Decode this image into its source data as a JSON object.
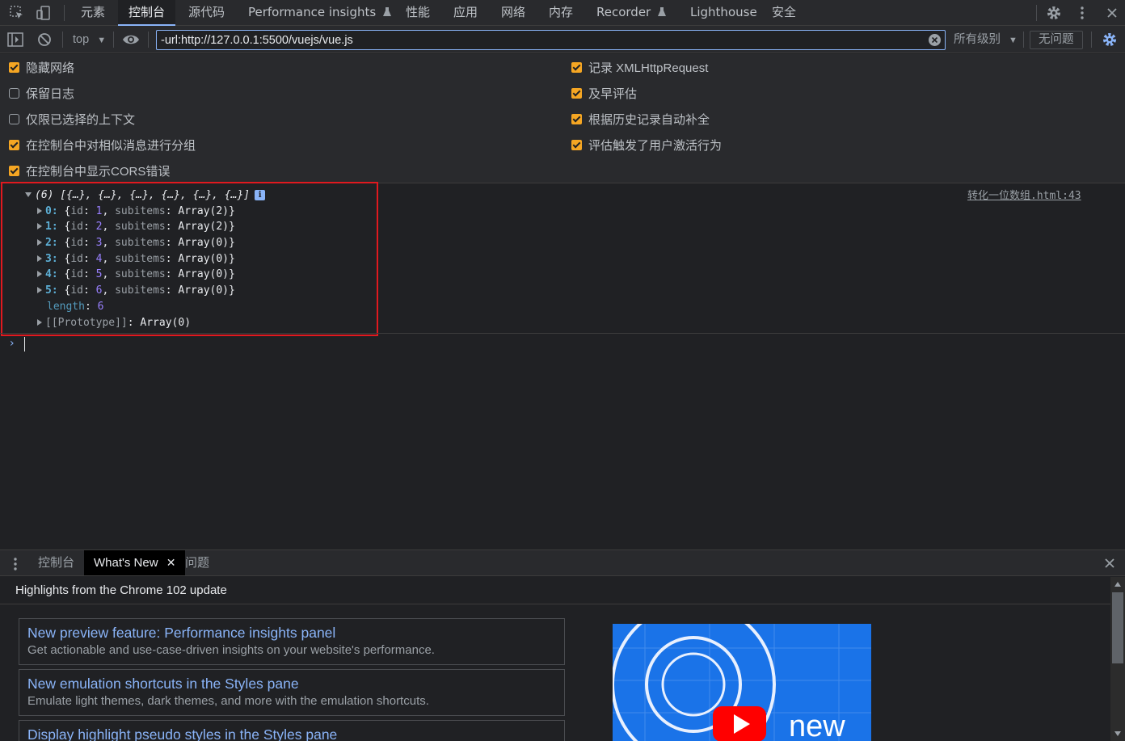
{
  "topbar": {
    "tabs": [
      {
        "label": "元素"
      },
      {
        "label": "控制台"
      },
      {
        "label": "源代码"
      },
      {
        "label": "Performance insights"
      },
      {
        "label": "性能"
      },
      {
        "label": "应用"
      },
      {
        "label": "网络"
      },
      {
        "label": "内存"
      },
      {
        "label": "Recorder"
      },
      {
        "label": "Lighthouse"
      },
      {
        "label": "安全"
      }
    ],
    "active_tab": "控制台"
  },
  "toolbar": {
    "context": "top",
    "filter_value": "-url:http://127.0.0.1:5500/vuejs/vue.js",
    "levels": "所有级别",
    "issues": "无问题"
  },
  "settings": {
    "left": [
      {
        "label": "隐藏网络",
        "checked": true
      },
      {
        "label": "保留日志",
        "checked": false
      },
      {
        "label": "仅限已选择的上下文",
        "checked": false
      },
      {
        "label": "在控制台中对相似消息进行分组",
        "checked": true
      },
      {
        "label": "在控制台中显示CORS错误",
        "checked": true
      }
    ],
    "right": [
      {
        "label": "记录 XMLHttpRequest",
        "checked": true
      },
      {
        "label": "及早评估",
        "checked": true
      },
      {
        "label": "根据历史记录自动补全",
        "checked": true
      },
      {
        "label": "评估触发了用户激活行为",
        "checked": true
      }
    ]
  },
  "console": {
    "summary": "(6) [{…}, {…}, {…}, {…}, {…}, {…}]",
    "source_link": "转化一位数组.html:43",
    "items": [
      {
        "index": "0",
        "id": "1",
        "subitems": "Array(2)"
      },
      {
        "index": "1",
        "id": "2",
        "subitems": "Array(2)"
      },
      {
        "index": "2",
        "id": "3",
        "subitems": "Array(0)"
      },
      {
        "index": "3",
        "id": "4",
        "subitems": "Array(0)"
      },
      {
        "index": "4",
        "id": "5",
        "subitems": "Array(0)"
      },
      {
        "index": "5",
        "id": "6",
        "subitems": "Array(0)"
      }
    ],
    "length_key": "length",
    "length_value": "6",
    "prototype_key": "[[Prototype]]",
    "prototype_value": "Array(0)"
  },
  "drawer": {
    "tabs": [
      {
        "label": "控制台"
      },
      {
        "label": "What's New"
      },
      {
        "label": "问题"
      }
    ],
    "heading": "Highlights from the Chrome 102 update",
    "cards": [
      {
        "title": "New preview feature: Performance insights panel",
        "desc": "Get actionable and use-case-driven insights on your website's performance."
      },
      {
        "title": "New emulation shortcuts in the Styles pane",
        "desc": "Emulate light themes, dark themes, and more with the emulation shortcuts."
      },
      {
        "title": "Display highlight pseudo styles in the Styles pane",
        "desc": ""
      }
    ],
    "promo_text": "new"
  },
  "colors": {
    "accent": "#8ab4f8",
    "checkbox": "#f5a623",
    "highlight_border": "#e0191f"
  }
}
